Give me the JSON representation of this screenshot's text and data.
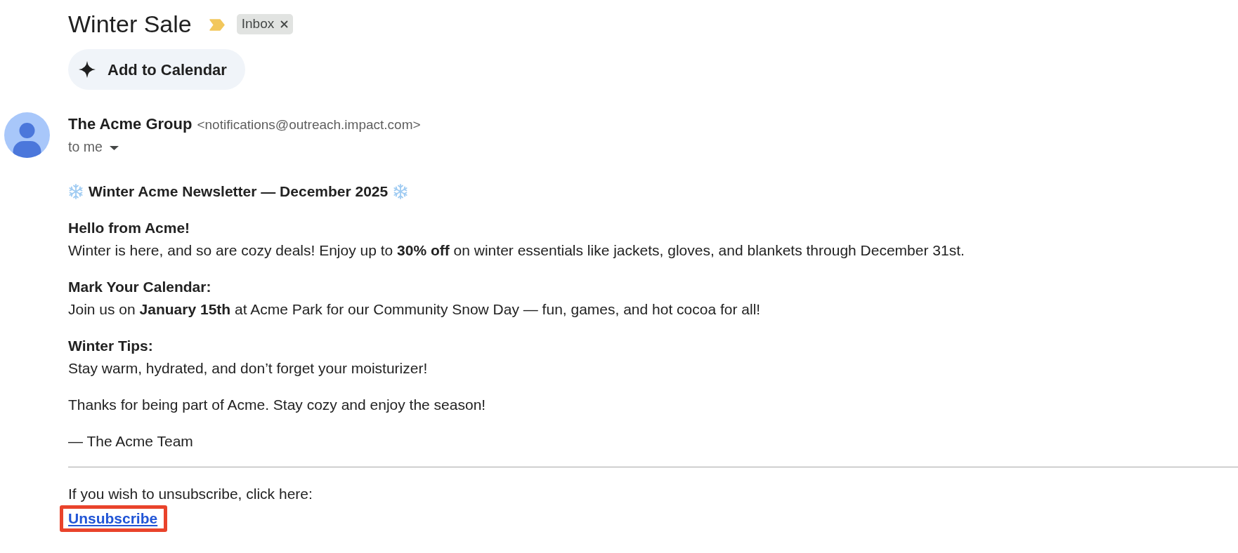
{
  "subject": {
    "title": "Winter Sale",
    "important": true,
    "labels": [
      {
        "name": "Inbox"
      }
    ]
  },
  "actions": [
    {
      "label": "Add to Calendar"
    }
  ],
  "message": {
    "sender": {
      "name": "The Acme Group",
      "email": "<notifications@outreach.impact.com>"
    },
    "recipients": "to me"
  },
  "body": {
    "heading": "Winter Acme Newsletter — December 2025",
    "sections": [
      {
        "title": "Hello from Acme!",
        "text": "Winter is here, and so are cozy deals! Enjoy up to **30% off** on winter essentials like jackets, gloves, and blankets through December 31st."
      },
      {
        "title": "Mark Your Calendar:",
        "text": "Join us on **January 15th** at Acme Park for our Community Snow Day — fun, games, and hot cocoa for all!"
      },
      {
        "title": "Winter Tips:",
        "text": "Stay warm, hydrated, and don’t forget your moisturizer!"
      }
    ],
    "closing": [
      "Thanks for being part of Acme. Stay cozy and enjoy the season!",
      "— The Acme Team"
    ]
  },
  "footer": {
    "text": "If you wish to unsubscribe, click here:",
    "link": {
      "label": "Unsubscribe",
      "highlighted": true
    }
  }
}
